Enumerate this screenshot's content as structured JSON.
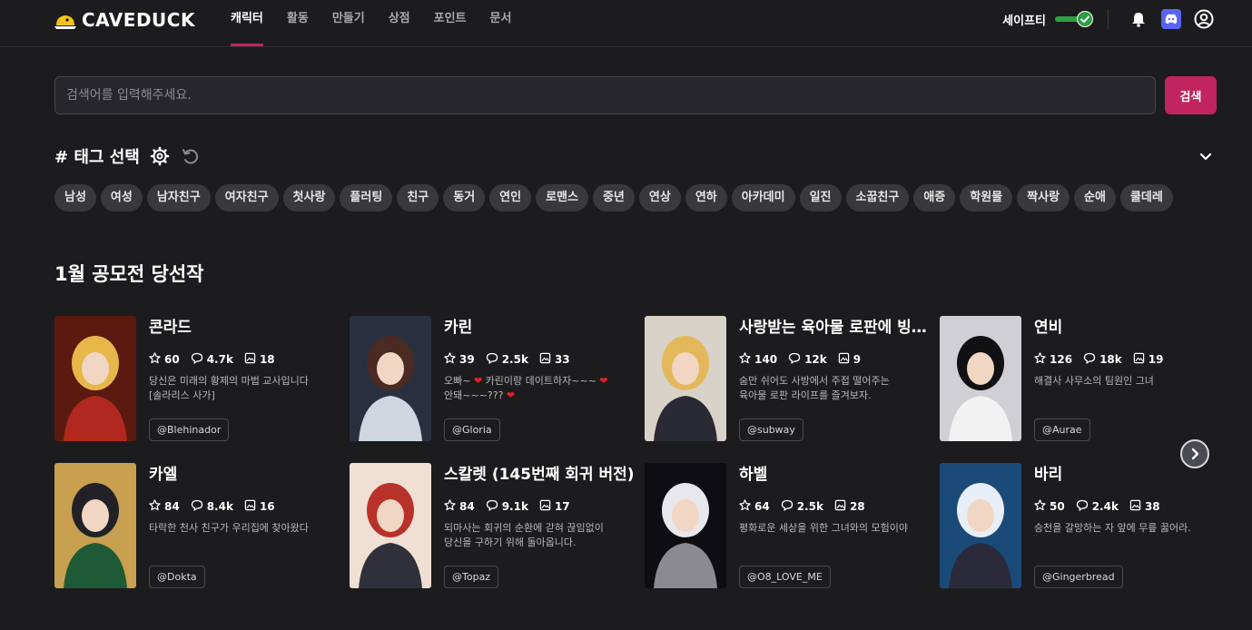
{
  "brand": {
    "name": "CAVEDUCK"
  },
  "nav": {
    "items": [
      {
        "label": "캐릭터",
        "active": true
      },
      {
        "label": "활동"
      },
      {
        "label": "만들기"
      },
      {
        "label": "상점"
      },
      {
        "label": "포인트"
      },
      {
        "label": "문서"
      }
    ],
    "safety_label": "세이프티",
    "safety_on": true,
    "icons": [
      "bell-icon",
      "discord-icon",
      "user-circle-icon"
    ]
  },
  "search": {
    "placeholder": "검색어를 입력해주세요.",
    "button_label": "검색"
  },
  "tags_section": {
    "title": "# 태그 선택",
    "tags": [
      "남성",
      "여성",
      "남자친구",
      "여자친구",
      "첫사랑",
      "플러팅",
      "친구",
      "동거",
      "연인",
      "로맨스",
      "중년",
      "연상",
      "연하",
      "아카데미",
      "일진",
      "소꿉친구",
      "애증",
      "학원물",
      "짝사랑",
      "순애",
      "쿨데레"
    ]
  },
  "featured": {
    "title": "1월 공모전 당선작",
    "cards": [
      {
        "title": "콘라드",
        "stars": "60",
        "chats": "4.7k",
        "images": "18",
        "desc1": "당신은 미래의 황제의 마법 교사입니다",
        "desc2": "[솔라리스 사가]",
        "author": "@Blehinador"
      },
      {
        "title": "카린",
        "stars": "39",
        "chats": "2.5k",
        "images": "33",
        "desc1": "오빠~ ❤ 카린이랑 데이트하자~~~ ❤",
        "desc2": "안돼~~~??? ❤",
        "author": "@Gloria"
      },
      {
        "title": "사랑받는 육아물 로판에 빙의했다",
        "stars": "140",
        "chats": "12k",
        "images": "9",
        "desc1": "숨만 쉬어도 사방에서 주접 떨어주는",
        "desc2": "육아물 로판 라이프를 즐겨보자.",
        "author": "@subway"
      },
      {
        "title": "연비",
        "stars": "126",
        "chats": "18k",
        "images": "19",
        "desc1": "해결사 사무소의 팀원인 그녀",
        "desc2": "",
        "author": "@Aurae"
      },
      {
        "title": "카엘",
        "stars": "84",
        "chats": "8.4k",
        "images": "16",
        "desc1": "타락한 천사 친구가 우리집에 찾아왔다",
        "desc2": "",
        "author": "@Dokta"
      },
      {
        "title": "스칼렛 (145번째 회귀 버전)",
        "stars": "84",
        "chats": "9.1k",
        "images": "17",
        "desc1": "되마사는 회귀의 순환에 갇혀 끊임없이",
        "desc2": "당신을 구하기 위해 돌아옵니다.",
        "author": "@Topaz"
      },
      {
        "title": "하벨",
        "stars": "64",
        "chats": "2.5k",
        "images": "28",
        "desc1": "평화로운 세상을 위한 그녀와의 모험이야",
        "desc2": "",
        "author": "@O8_LOVE_ME"
      },
      {
        "title": "바리",
        "stars": "50",
        "chats": "2.4k",
        "images": "38",
        "desc1": "승천을 갈망하는 자 앞에 무릎 꿇어라.",
        "desc2": "",
        "author": "@Gingerbread"
      }
    ]
  },
  "colors": {
    "accent": "#c2245d",
    "background": "#1c1c1f",
    "tag_bg": "#38383d",
    "toggle_on": "#2ea043"
  }
}
